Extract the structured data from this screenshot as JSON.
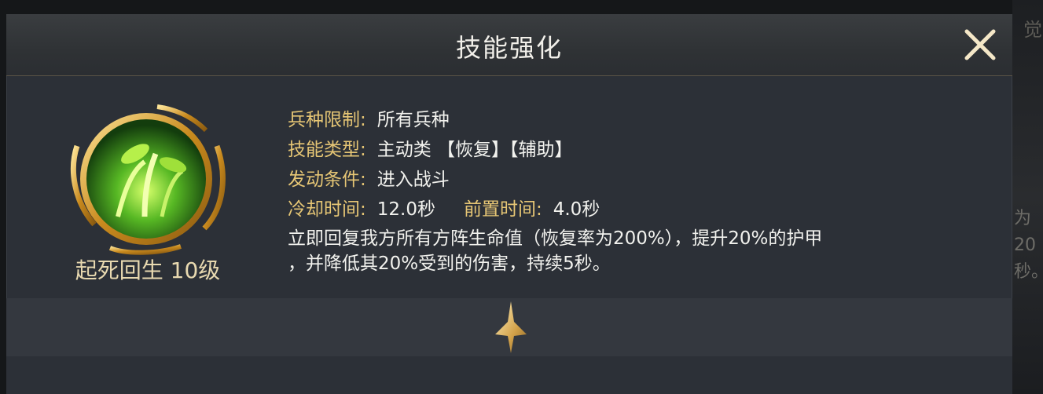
{
  "dialog": {
    "title": "技能强化",
    "close_icon": "close-icon"
  },
  "skill": {
    "icon": "sprout-heal-icon",
    "name_level": "起死回生 10级"
  },
  "details": {
    "troop_limit_label": "兵种限制:",
    "troop_limit_value": "所有兵种",
    "skill_type_label": "技能类型:",
    "skill_type_value": "主动类 【恢复】【辅助】",
    "trigger_label": "发动条件:",
    "trigger_value": "进入战斗",
    "cooldown_label": "冷却时间:",
    "cooldown_value": "12.0秒",
    "precast_label": "前置时间:",
    "precast_value": "4.0秒",
    "description_line1": "立即回复我方所有方阵生命值（恢复率为200%），提升20%的护甲",
    "description_line2": "，并降低其20%受到的伤害，持续5秒。"
  },
  "divider_icon": "gold-arrow-down-icon",
  "background": {
    "edge_text_top": "觉",
    "edge_text_line1": "为20",
    "edge_text_line2": "秒。"
  },
  "colors": {
    "label_gold": "#e6c675",
    "panel": "#2c3037",
    "band": "#34383f"
  }
}
